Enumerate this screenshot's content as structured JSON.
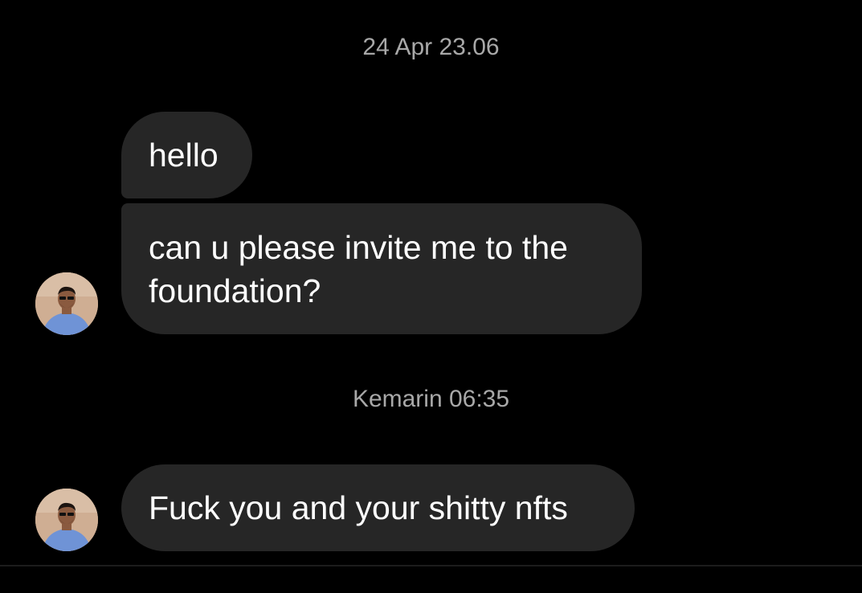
{
  "conversation": {
    "timestamps": [
      "24 Apr 23.06",
      "Kemarin 06:35"
    ],
    "messages": [
      {
        "text": "hello"
      },
      {
        "text": "can u please invite me to the foundation?"
      },
      {
        "text": "Fuck you and your shitty nfts"
      }
    ]
  },
  "colors": {
    "background": "#000000",
    "bubble": "#262626",
    "timestamp_text": "#a8a8a8",
    "message_text": "#ffffff"
  },
  "icons": {
    "avatar": "profile-photo-avatar"
  }
}
